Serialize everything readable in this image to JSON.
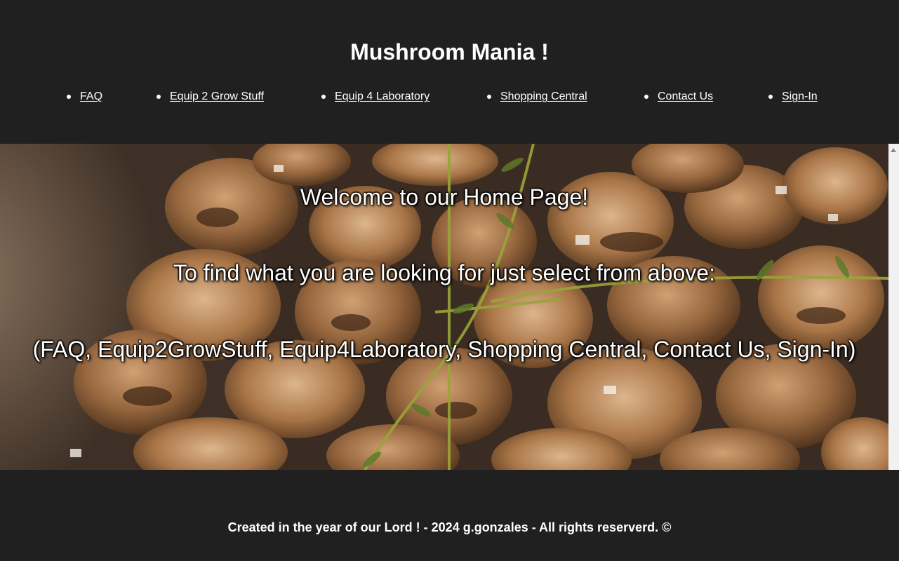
{
  "header": {
    "title": "Mushroom Mania !"
  },
  "nav": {
    "items": [
      {
        "label": "FAQ"
      },
      {
        "label": "Equip 2 Grow Stuff"
      },
      {
        "label": "Equip 4 Laboratory"
      },
      {
        "label": "Shopping Central"
      },
      {
        "label": "Contact Us"
      },
      {
        "label": "Sign-In"
      }
    ]
  },
  "hero": {
    "image_icon": "mushroom-photo",
    "line1": "Welcome to our Home Page!",
    "line2": "To find what you are looking for just select from above:",
    "line3": "(FAQ, Equip2GrowStuff, Equip4Laboratory, Shopping Central, Contact Us, Sign-In)"
  },
  "footer": {
    "text": "Created in the year of our Lord ! - 2024 g.gonzales - All rights reserverd. ©"
  },
  "colors": {
    "background": "#202020",
    "text": "#ffffff"
  }
}
